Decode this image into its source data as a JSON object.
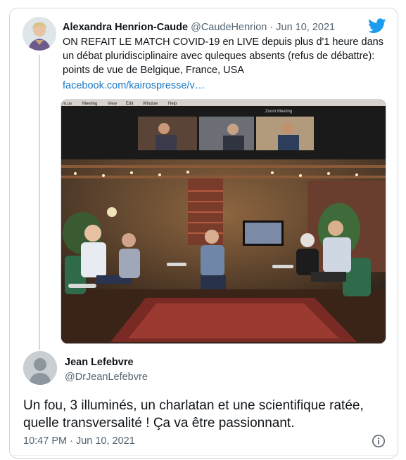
{
  "quoted_tweet": {
    "author_name": "Alexandra Henrion-Caude",
    "handle": "@CaudeHenrion",
    "separator": "·",
    "date": "Jun 10, 2021",
    "text": "ON REFAIT LE MATCH COVID-19 en LIVE depuis plus d'1 heure dans un débat pluridisciplinaire avec quleques absents (refus de débattre): points de vue de Belgique, France, USA",
    "link": "facebook.com/kairospresse/v…",
    "media": {
      "menu_items": [
        "m.us",
        "Meeting",
        "View",
        "Edit",
        "Window",
        "Help"
      ],
      "window_title": "Zoom Meeting"
    }
  },
  "reply": {
    "author_name": "Jean Lefebvre",
    "handle": "@DrJeanLefebvre",
    "text": "Un fou, 3 illuminés, un charlatan et une scientifique ratée, quelle transversalité ! Ça va être passionnant.",
    "timestamp": "10:47 PM · Jun 10, 2021"
  },
  "icons": {
    "brand": "twitter-bird-icon",
    "info": "info-circle-icon",
    "default_avatar": "default-avatar-icon"
  },
  "colors": {
    "twitter_blue": "#1d9bf0",
    "link_blue": "#1b78c4",
    "text_primary": "#0f1419",
    "text_secondary": "#536471"
  }
}
